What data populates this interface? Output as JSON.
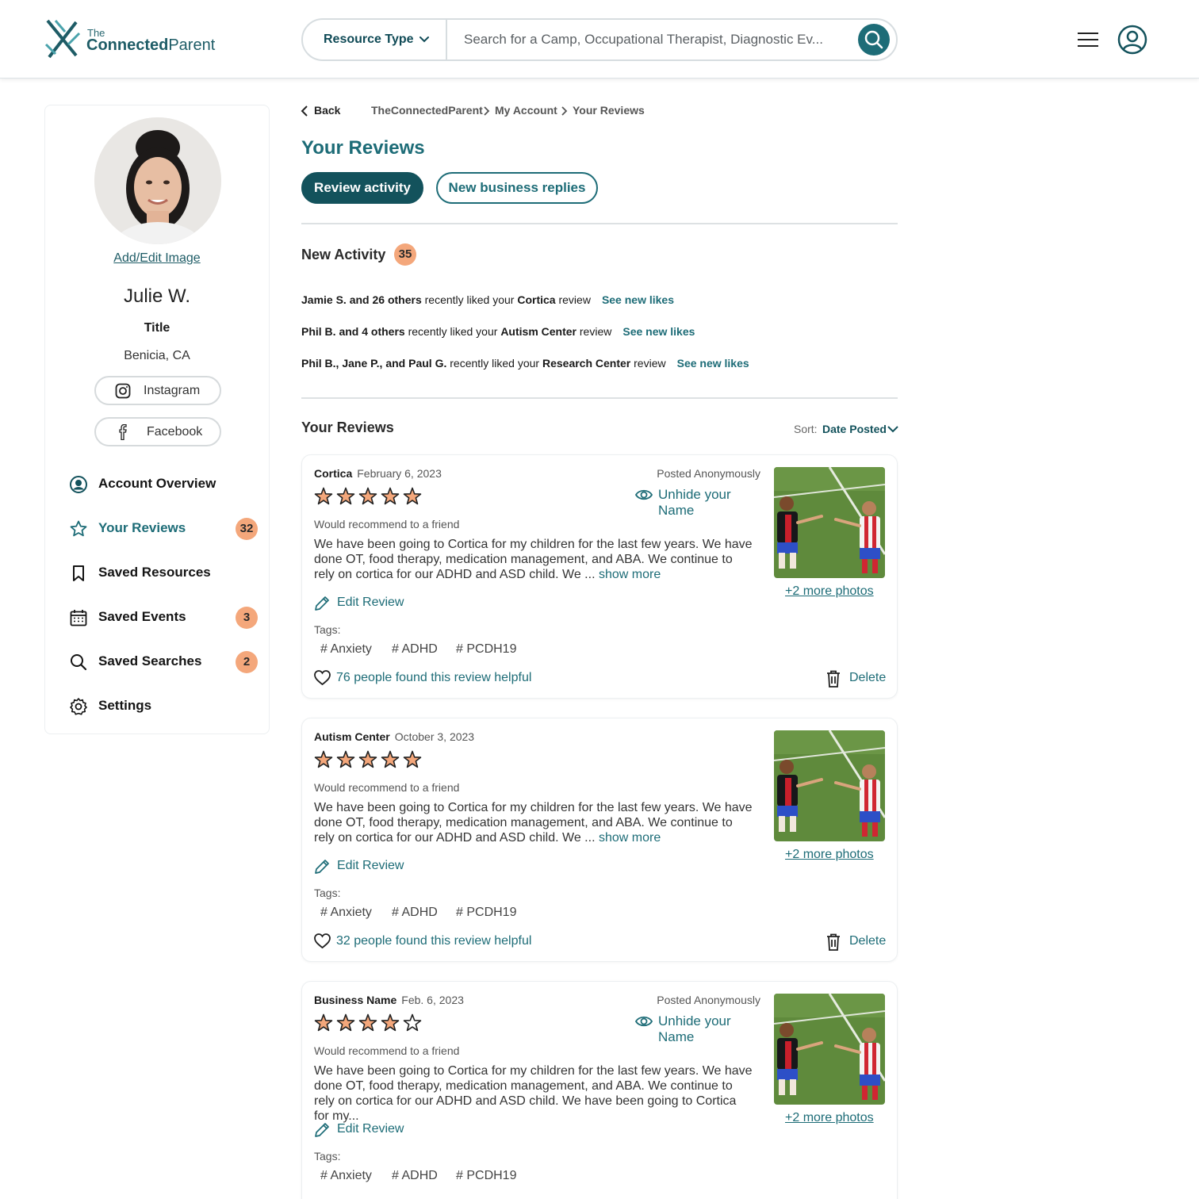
{
  "header": {
    "logo_the": "The",
    "logo_connected": "Connected",
    "logo_parent": "Parent",
    "resource_type_label": "Resource Type",
    "search_placeholder": "Search for a Camp, Occupational Therapist, Diagnostic Ev...",
    "icons": [
      "chevron-down-icon",
      "search-icon",
      "menu-icon",
      "user-icon"
    ]
  },
  "sidebar": {
    "add_edit_image": "Add/Edit Image",
    "name": "Julie W.",
    "title": "Title",
    "location": "Benicia, CA",
    "socials": [
      {
        "label": "Instagram",
        "icon": "instagram-icon"
      },
      {
        "label": "Facebook",
        "icon": "facebook-icon"
      }
    ],
    "nav": [
      {
        "label": "Account Overview",
        "icon": "account-icon",
        "badge": null,
        "active": false
      },
      {
        "label": "Your Reviews",
        "icon": "star-icon",
        "badge": "32",
        "active": true
      },
      {
        "label": "Saved Resources",
        "icon": "bookmark-icon",
        "badge": null,
        "active": false
      },
      {
        "label": "Saved Events",
        "icon": "calendar-icon",
        "badge": "3",
        "active": false
      },
      {
        "label": "Saved Searches",
        "icon": "search-icon",
        "badge": "2",
        "active": false
      },
      {
        "label": "Settings",
        "icon": "gear-icon",
        "badge": null,
        "active": false
      }
    ]
  },
  "breadcrumb": {
    "back": "Back",
    "items": [
      "TheConnectedParent",
      "My Account",
      "Your Reviews"
    ]
  },
  "page_title": "Your Reviews",
  "tabs": {
    "active": "Review activity",
    "inactive": "New business replies"
  },
  "new_activity": {
    "title": "New Activity",
    "count": "35",
    "items": [
      {
        "who": "Jamie S. and 26 others",
        "middle": " recently liked your ",
        "target": "Cortica",
        "suffix": " review",
        "link": "See new likes"
      },
      {
        "who": "Phil B.  and 4 others",
        "middle": " recently liked your ",
        "target": "Autism Center",
        "suffix": " review",
        "link": "See new likes"
      },
      {
        "who": "Phil B., Jane P., and Paul G.",
        "middle": " recently liked your ",
        "target": "Research Center",
        "suffix": " review",
        "link": "See new likes"
      }
    ]
  },
  "reviews_section": {
    "title": "Your Reviews",
    "sort_label": "Sort:",
    "sort_value": "Date Posted"
  },
  "reviews": [
    {
      "business": "Cortica",
      "date": "February 6, 2023",
      "rating": 5,
      "posted_anonymously": "Posted Anonymously",
      "unhide": "Unhide your Name",
      "recommend": "Would recommend to a friend",
      "text": "We have been going to Cortica for my children for the last few years. We have done OT, food therapy, medication management, and ABA. We continue to rely on cortica for our ADHD and ASD child. We ... ",
      "show_more": "show more",
      "edit": "Edit Review",
      "tags_label": "Tags:",
      "tags": [
        "# Anxiety",
        "# ADHD",
        "# PCDH19"
      ],
      "helpful": "76 people found this review helpful",
      "delete": "Delete",
      "more_photos": "+2 more photos"
    },
    {
      "business": "Autism Center",
      "date": "October 3, 2023",
      "rating": 5,
      "recommend": "Would recommend to a friend",
      "text": "We have been going to Cortica for my children for the last few years. We have done OT, food therapy, medication management, and ABA. We continue to rely on cortica for our ADHD and ASD child. We ... ",
      "show_more": "show more",
      "edit": "Edit Review",
      "tags_label": "Tags:",
      "tags": [
        "# Anxiety",
        "# ADHD",
        "# PCDH19"
      ],
      "helpful": "32 people found this review helpful",
      "delete": "Delete",
      "more_photos": "+2 more photos"
    },
    {
      "business": "Business Name",
      "date": "Feb. 6, 2023",
      "rating": 4,
      "posted_anonymously": "Posted Anonymously",
      "unhide": "Unhide your Name",
      "recommend": "Would recommend to a friend",
      "text": "We have been going to Cortica for my children for the last few years. We have done OT, food therapy, medication management, and ABA. We continue to rely on cortica for our ADHD and ASD child. We have been going to Cortica for my...",
      "edit": "Edit Review",
      "tags_label": "Tags:",
      "tags": [
        "# Anxiety",
        "# ADHD",
        "# PCDH19"
      ],
      "more_photos": "+2 more photos"
    }
  ],
  "colors": {
    "brand_teal": "#1d6c77",
    "brand_dark": "#13525c",
    "badge_orange": "#f4a77b",
    "star_fill": "#f4a77b"
  }
}
